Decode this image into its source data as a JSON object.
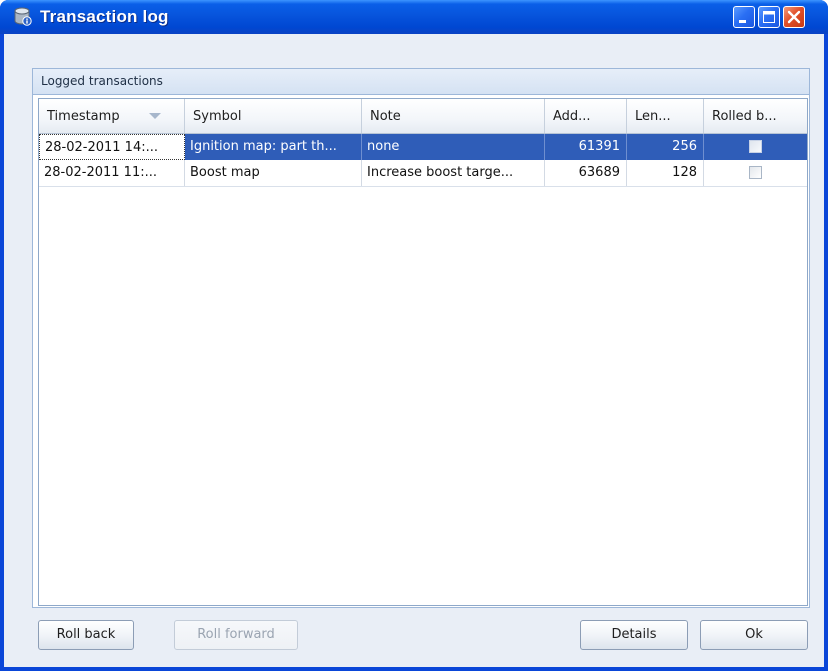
{
  "window": {
    "title": "Transaction log",
    "icon": "database-icon",
    "caption_buttons": [
      "minimize-icon",
      "maximize-icon",
      "close-icon"
    ]
  },
  "group": {
    "title": "Logged transactions"
  },
  "grid": {
    "columns": [
      "Timestamp",
      "Symbol",
      "Note",
      "Add...",
      "Len...",
      "Rolled b..."
    ],
    "sorted_column": "Timestamp",
    "rows": [
      {
        "timestamp": "28-02-2011 14:...",
        "symbol": "Ignition map: part th...",
        "note": "none",
        "address": "61391",
        "length": "256",
        "rolled_back": false,
        "selected": true
      },
      {
        "timestamp": "28-02-2011 11:...",
        "symbol": "Boost map",
        "note": "Increase boost targe...",
        "address": "63689",
        "length": "128",
        "rolled_back": false,
        "selected": false
      }
    ]
  },
  "buttons": {
    "roll_back": "Roll back",
    "roll_forward": "Roll forward",
    "details": "Details",
    "ok": "Ok"
  },
  "colors": {
    "titlebar": "#0754dc",
    "selection": "#2f5db8",
    "client_background": "#e9eef6"
  }
}
